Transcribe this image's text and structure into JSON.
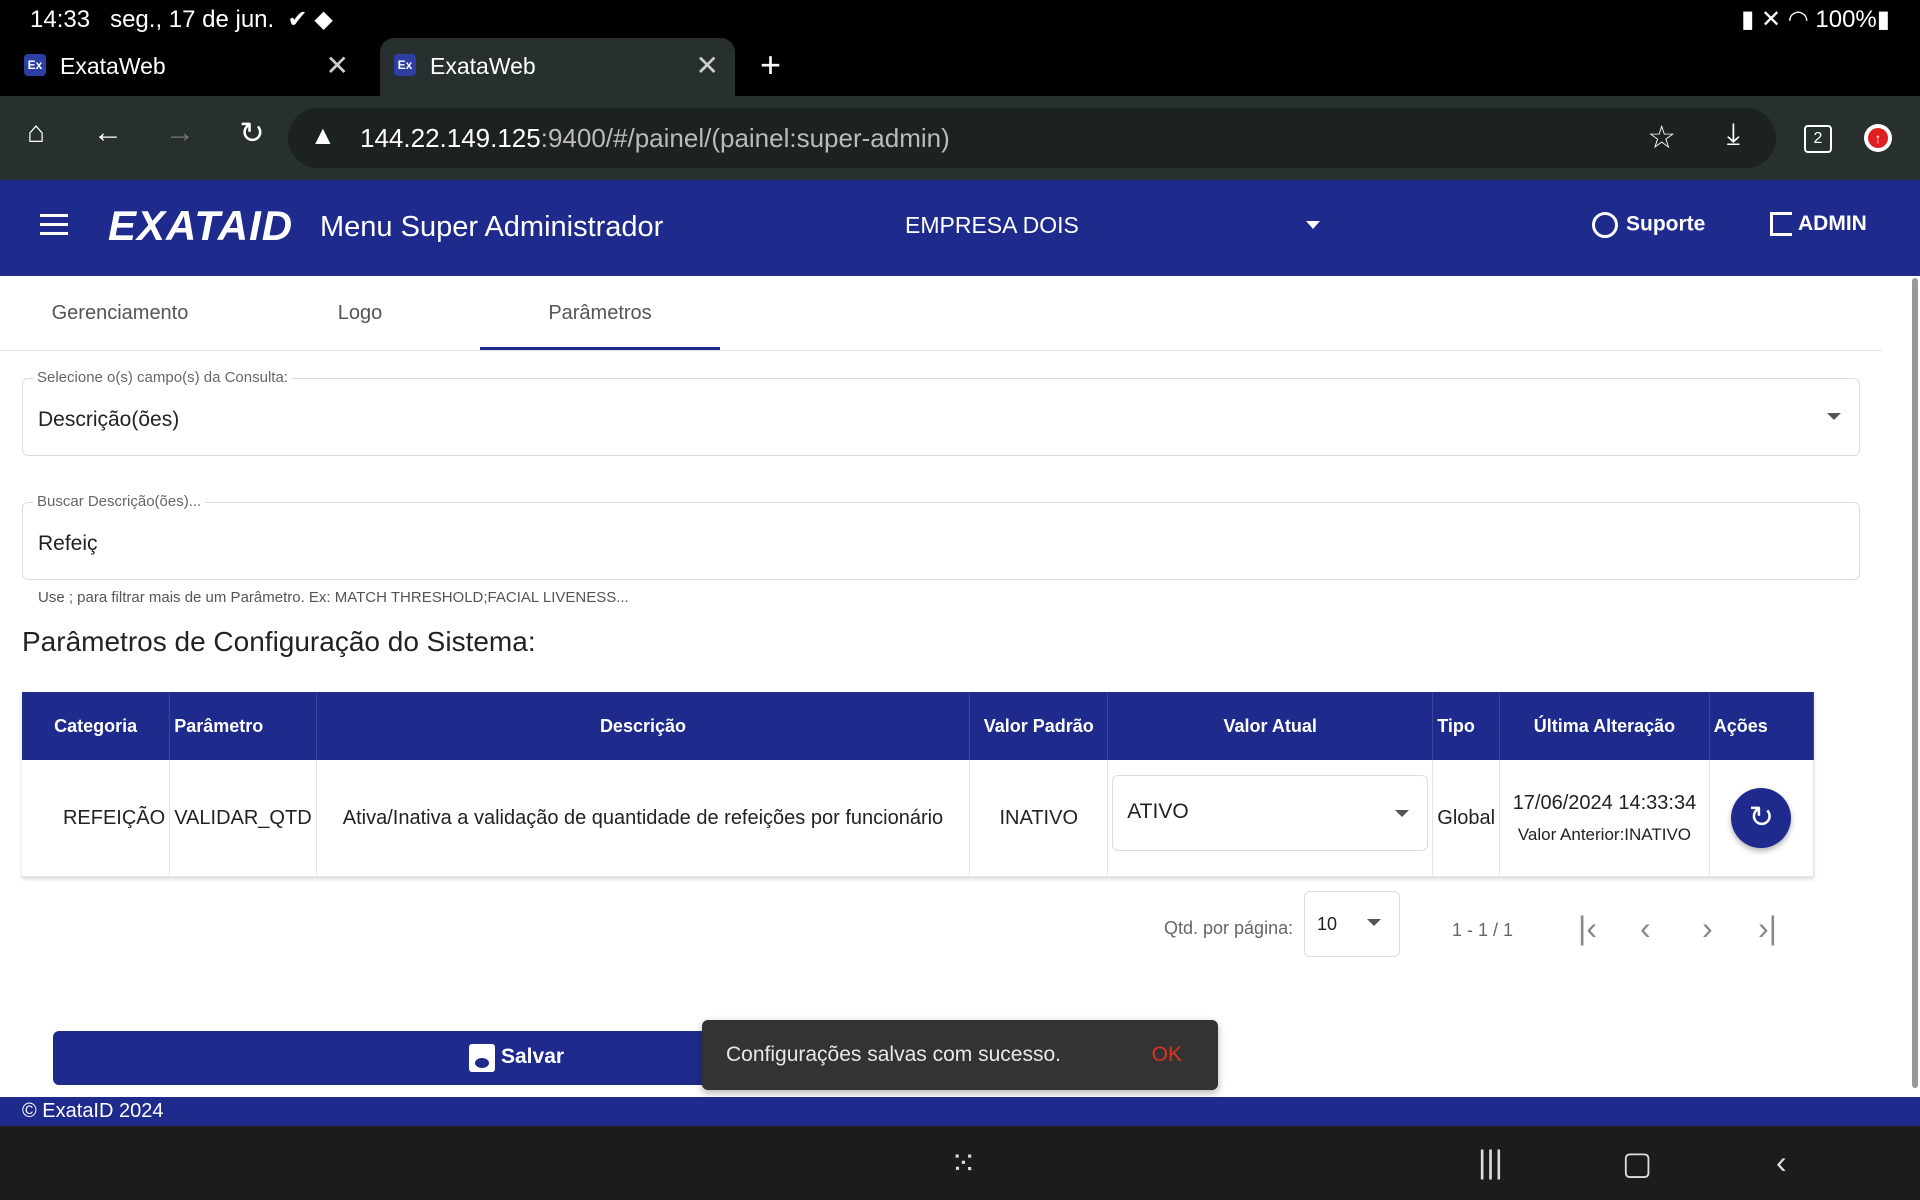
{
  "status": {
    "time": "14:33",
    "date": "seg., 17 de jun.",
    "battery": "100%"
  },
  "browser": {
    "tabs": [
      {
        "favicon": "Ex",
        "title": "ExataWeb"
      },
      {
        "favicon": "Ex",
        "title": "ExataWeb"
      }
    ],
    "url_host": "144.22.149.125",
    "url_rest": ":9400/#/painel/(painel:super-admin)",
    "tab_count": "2"
  },
  "header": {
    "logo": "EXATAID",
    "title": "Menu Super Administrador",
    "company": "EMPRESA DOIS",
    "support": "Suporte",
    "user": "ADMIN"
  },
  "tabs": [
    "Gerenciamento",
    "Logo",
    "Parâmetros"
  ],
  "query_field": {
    "label": "Selecione o(s) campo(s) da Consulta:",
    "value": "Descrição(ões)"
  },
  "search_field": {
    "label": "Buscar Descrição(ões)...",
    "value": "Refeiç"
  },
  "hint": "Use ; para filtrar mais de um Parâmetro. Ex: MATCH THRESHOLD;FACIAL LIVENESS...",
  "section_title": "Parâmetros de Configuração do Sistema:",
  "table": {
    "columns": [
      "Categoria",
      "Parâmetro",
      "Descrição",
      "Valor Padrão",
      "Valor Atual",
      "Tipo",
      "Última Alteração",
      "Ações"
    ],
    "rows": [
      {
        "categoria": "REFEIÇÃO",
        "parametro": "VALIDAR_QTD",
        "descricao": "Ativa/Inativa a validação de quantidade de refeições por funcionário",
        "valor_padrao": "INATIVO",
        "valor_atual": "ATIVO",
        "tipo": "Global",
        "ultima_alteracao": "17/06/2024 14:33:34",
        "valor_anterior": "Valor Anterior:INATIVO"
      }
    ]
  },
  "paginator": {
    "label": "Qtd. por página:",
    "page_size": "10",
    "range": "1 - 1 / 1"
  },
  "save_label": "Salvar",
  "snackbar": {
    "message": "Configurações salvas com sucesso.",
    "action": "OK"
  },
  "footer": "© ExataID 2024"
}
